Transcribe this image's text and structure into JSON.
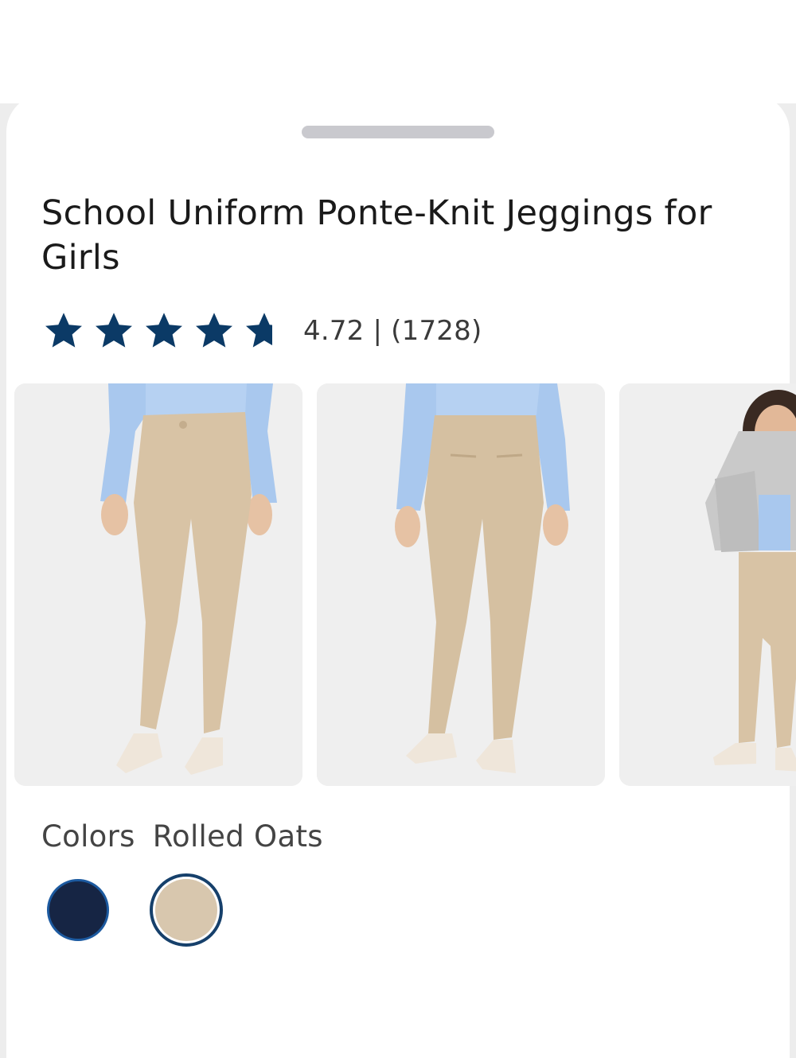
{
  "product": {
    "title": "School Uniform Ponte-Knit Jeggings for Girls",
    "rating_text": "4.72 | (1728)",
    "rating_value": 4.72,
    "rating_max": 5,
    "review_count": 1728
  },
  "gallery": {
    "images": [
      {
        "alt": "front view of khaki jeggings"
      },
      {
        "alt": "back view of khaki jeggings"
      },
      {
        "alt": "model wearing gray hoodie and khaki jeggings"
      }
    ]
  },
  "colors": {
    "label": "Colors",
    "selected_name": "Rolled Oats",
    "swatches": [
      {
        "name": "navy",
        "hex": "#162544",
        "selected": false
      },
      {
        "name": "Rolled Oats",
        "hex": "#d8c7ae",
        "selected": true
      }
    ]
  },
  "theme": {
    "star_color": "#0b3a66",
    "handle_color": "#c9c9ce",
    "selected_ring": "#16406b"
  }
}
